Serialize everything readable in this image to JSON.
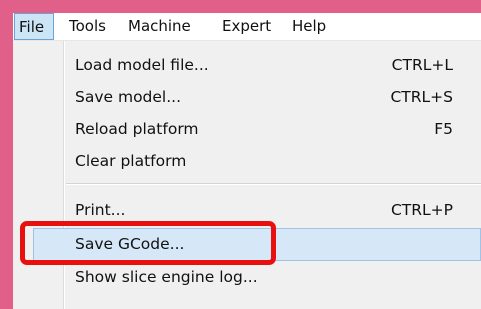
{
  "menubar": {
    "items": [
      {
        "label": "File"
      },
      {
        "label": "Tools"
      },
      {
        "label": "Machine"
      },
      {
        "label": "Expert"
      },
      {
        "label": "Help"
      }
    ]
  },
  "file_menu": {
    "items": [
      {
        "label": "Load model file...",
        "shortcut": "CTRL+L"
      },
      {
        "label": "Save model...",
        "shortcut": "CTRL+S"
      },
      {
        "label": "Reload platform",
        "shortcut": "F5"
      },
      {
        "label": "Clear platform",
        "shortcut": ""
      },
      {
        "label": "Print...",
        "shortcut": "CTRL+P"
      },
      {
        "label": "Save GCode...",
        "shortcut": ""
      },
      {
        "label": "Show slice engine log...",
        "shortcut": ""
      }
    ]
  },
  "colors": {
    "background": "#e0608a",
    "highlight": "#d6e8f7",
    "annotation_box": "#e8100f"
  }
}
